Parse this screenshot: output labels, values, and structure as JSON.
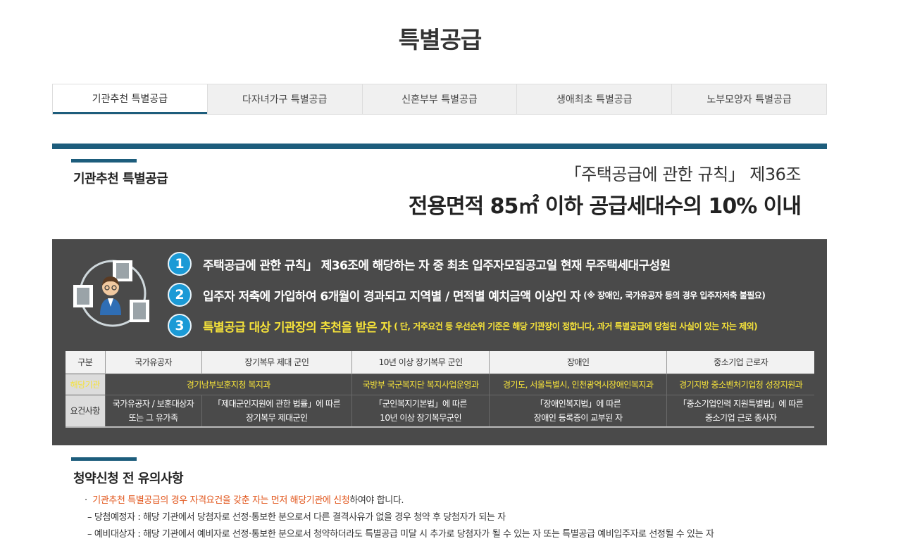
{
  "page": {
    "title": "특별공급"
  },
  "tabs": [
    {
      "label": "기관추천 특별공급",
      "active": true
    },
    {
      "label": "다자녀가구 특별공급",
      "active": false
    },
    {
      "label": "신혼부부 특별공급",
      "active": false
    },
    {
      "label": "생애최초 특별공급",
      "active": false
    },
    {
      "label": "노부모양자 특별공급",
      "active": false
    }
  ],
  "section1": {
    "title": "기관추천 특별공급",
    "rule_ref": "「주택공급에 관한 규칙」 제36조",
    "rule_main": "전용면적 85㎡ 이하 공급세대수의 10% 이내"
  },
  "conditions": [
    {
      "num": "1",
      "text": "주택공급에 관한 규칙」 제36조에 해당하는 자 중 최초 입주자모집공고일 현재 무주택세대구성원",
      "note": ""
    },
    {
      "num": "2",
      "text": "입주자 저축에 가입하여 6개월이 경과되고 지역별 / 면적별 예치금액 이상인 자",
      "note": "(※ 장애인, 국가유공자 등의 경우 입주자저축 불필요)"
    },
    {
      "num": "3",
      "text": "특별공급 대상 기관장의 추천을 받은 자",
      "note": "( 단, 거주요건 등 우선순위 기준은 해당 기관장이 정합니다, 과거 특별공급에 당첨된 사실이 있는 자는 제외)"
    }
  ],
  "table": {
    "headers": [
      "구분",
      "국가유공자",
      "장기복무 제대 군인",
      "10년 이상 장기복무 군인",
      "장애인",
      "중소기업 근로자"
    ],
    "row1": {
      "label": "해당기관",
      "cells": [
        "경기남부보훈지청 복지과",
        "국방부 국군복지단 복지사업운영과",
        "경기도, 서울특별시, 인천광역시장애인복지과",
        "경기지방 중소벤처기업청 성장지원과"
      ]
    },
    "row2": {
      "label": "요건사항",
      "cells": [
        {
          "l1": "국가유공자 / 보훈대상자",
          "l2": "또는 그 유가족"
        },
        {
          "l1": "「제대군인지원에 관한 법률」에 따른",
          "l2": "장기복무 제대군인"
        },
        {
          "l1": "「군인복지기본법」에 따른",
          "l2": "10년 이상 장기복무군인"
        },
        {
          "l1": "「장애인복지법」에 따른",
          "l2": "장애인 등록증이 교부된 자"
        },
        {
          "l1": "「중소기업인력 지원특별법」에 따른",
          "l2": "중소기업 근로 종사자"
        }
      ]
    }
  },
  "section2": {
    "title": "청약신청 전 유의사항",
    "bullet": "·",
    "note1_highlight": "기관추천 특별공급의 경우 자격요건을 갖춘 자는 먼저 해당기관에 신청",
    "note1_rest": "하여야 합니다.",
    "note2": "– 당첨예정자 : 해당 기관에서 당첨자로 선정·통보한 분으로서 다른 결격사유가 없을 경우 청약 후 당첨자가 되는 자",
    "note3": "– 예비대상자 : 해당 기관에서 예비자로 선정·통보한 분으로서 청약하더라도 특별공급 미달 시 추가로 당첨자가 될 수 있는 자 또는 특별공급 예비입주자로 선정될 수 있는 자"
  },
  "colors": {
    "accent": "#1d5d7c",
    "dark_panel": "#4a4a4a",
    "number_badge": "#1b9ad6",
    "highlight_yellow": "#f5e23a",
    "highlight_orange": "#e2561c"
  }
}
